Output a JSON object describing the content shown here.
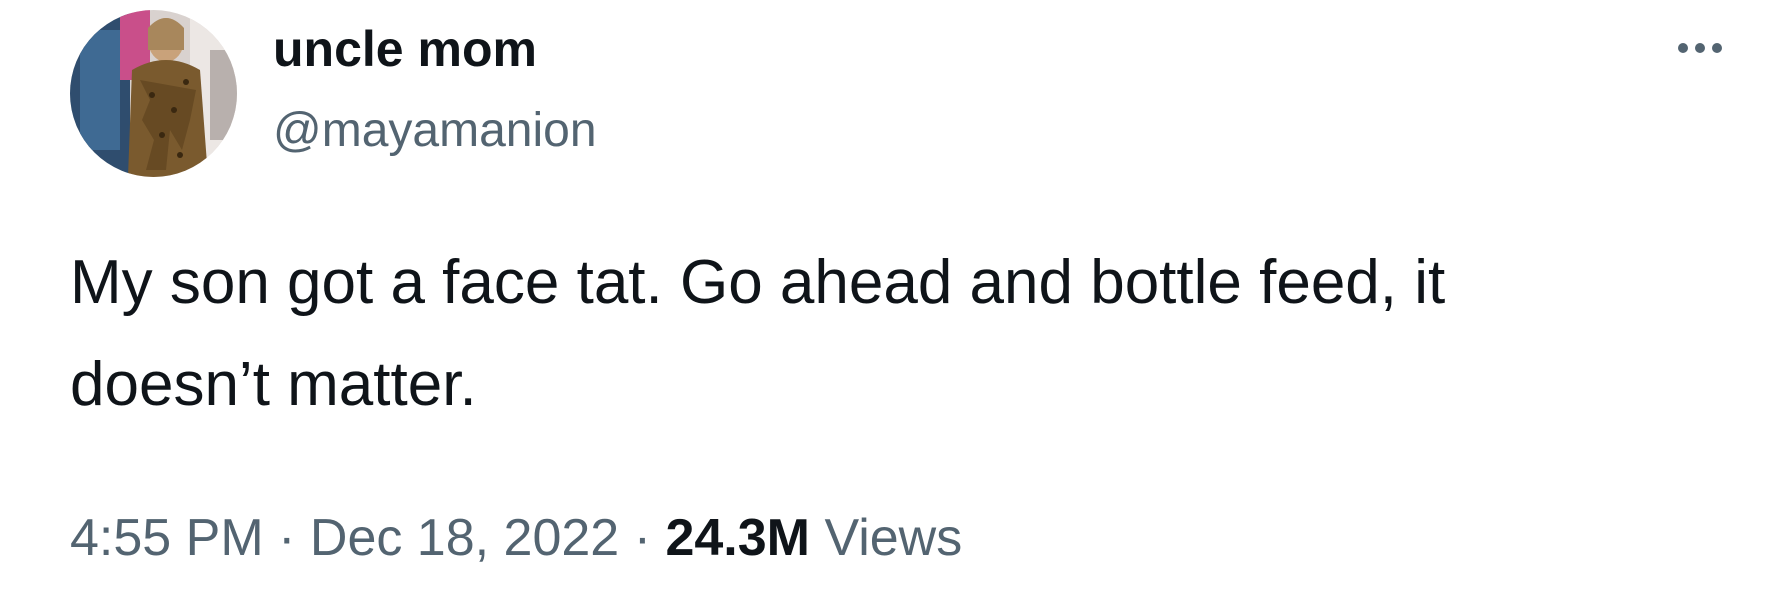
{
  "tweet": {
    "author": {
      "display_name": "uncle mom",
      "handle": "@mayamanion",
      "avatar": "profile-photo"
    },
    "more_icon": "more-horizontal-icon",
    "text": "My son got a face tat. Go ahead and bottle feed, it\ndoesn’t matter.",
    "meta": {
      "time": "4:55 PM",
      "separator": "·",
      "date": "Dec 18, 2022",
      "views_count": "24.3M",
      "views_label": "Views"
    }
  },
  "colors": {
    "text_primary": "#0f1419",
    "text_secondary": "#536471",
    "background": "#ffffff"
  }
}
